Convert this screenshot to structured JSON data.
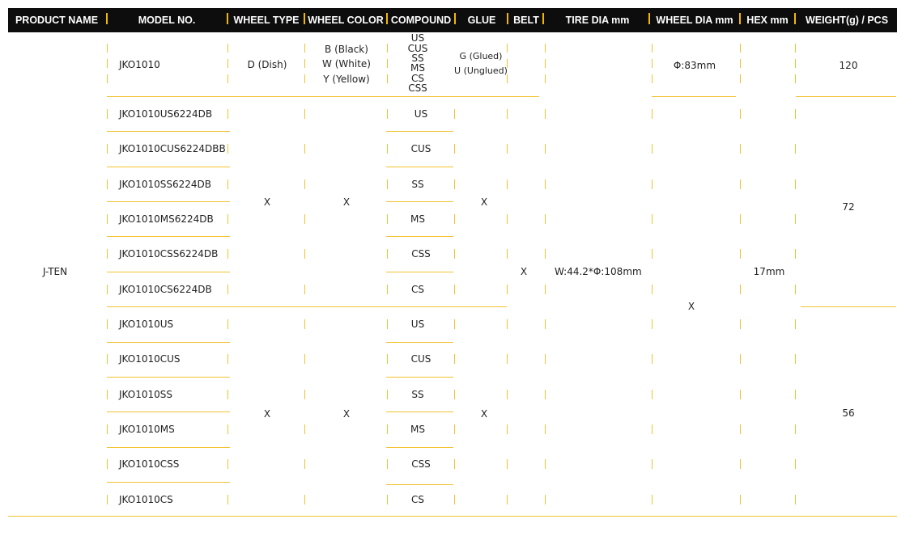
{
  "header": {
    "columns": [
      "PRODUCT NAME",
      "MODEL NO.",
      "WHEEL TYPE",
      "WHEEL COLOR",
      "COMPOUND",
      "GLUE",
      "BELT",
      "TIRE DIA mm",
      "WHEEL DIA mm",
      "HEX mm",
      "WEIGHT(g) / PCS"
    ]
  },
  "product_name": "J-TEN",
  "row0": {
    "model": "JKO1010",
    "wheel_type": "D (Dish)",
    "colors": [
      "B (Black)",
      "W (White)",
      "Y (Yellow)"
    ],
    "compounds": [
      "US",
      "CUS",
      "SS",
      "MS",
      "CS",
      "CSS"
    ],
    "glue": [
      "G (Glued)",
      "U (Unglued)"
    ],
    "wheel_dia": "Φ:83mm",
    "weight": "120"
  },
  "group1": {
    "models": [
      "JKO1010US6224DB",
      "JKO1010CUS6224DBB",
      "JKO1010SS6224DB",
      "JKO1010MS6224DB",
      "JKO1010CSS6224DB",
      "JKO1010CS6224DB"
    ],
    "compounds": [
      "US",
      "CUS",
      "SS",
      "MS",
      "CSS",
      "CS"
    ],
    "wheel_type": "X",
    "wheel_color": "X",
    "glue": "X",
    "weight": "72"
  },
  "group2": {
    "models": [
      "JKO1010US",
      "JKO1010CUS",
      "JKO1010SS",
      "JKO1010MS",
      "JKO1010CSS",
      "JKO1010CS"
    ],
    "compounds": [
      "US",
      "CUS",
      "SS",
      "MS",
      "CSS",
      "CS"
    ],
    "wheel_type": "X",
    "wheel_color": "X",
    "glue": "X",
    "weight": "56"
  },
  "shared": {
    "belt": "X",
    "tire_dia": "W:44.2*Φ:108mm",
    "wheel_dia": "X",
    "hex": "17mm"
  },
  "colors": {
    "header_bg": "#0d0d0d",
    "accent": "#f2c230",
    "header_text": "#ffffff"
  }
}
